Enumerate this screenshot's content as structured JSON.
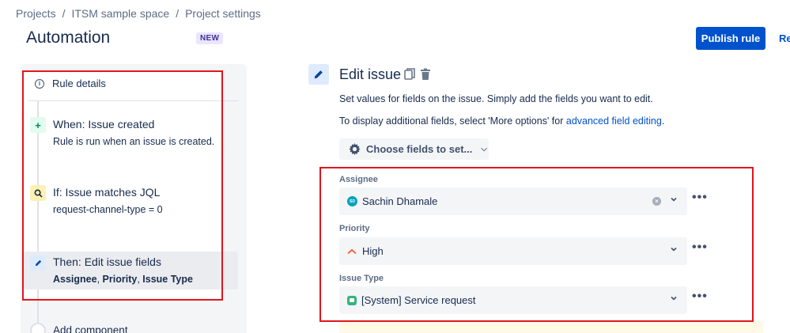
{
  "breadcrumb": [
    "Projects",
    "ITSM sample space",
    "Project settings"
  ],
  "header": {
    "title": "Automation",
    "badge": "NEW",
    "publish_label": "Publish rule",
    "secondary_label": "Re"
  },
  "rule": {
    "details_label": "Rule details",
    "when_title": "When: Issue created",
    "when_sub": "Rule is run when an issue is created.",
    "if_title": "If: Issue matches JQL",
    "if_sub": "request-channel-type = 0",
    "then_title": "Then: Edit issue fields",
    "then_fields": [
      "Assignee",
      "Priority",
      "Issue Type"
    ],
    "add_label": "Add component"
  },
  "editor": {
    "title": "Edit issue",
    "desc1": "Set values for fields on the issue. Simply add the fields you want to edit.",
    "desc2_prefix": "To display additional fields, select 'More options' for ",
    "desc2_link": "advanced field editing",
    "desc2_suffix": ".",
    "choose_label": "Choose fields to set...",
    "fields": [
      {
        "label": "Assignee",
        "value": "Sachin Dhamale",
        "avatar": "SD"
      },
      {
        "label": "Priority",
        "value": "High"
      },
      {
        "label": "Issue Type",
        "value": "[System] Service request"
      }
    ]
  },
  "colors": {
    "accent": "#0052cc",
    "highlight_box": "#e0161b",
    "priority_high": "#ff5630",
    "service_request": "#36b37e"
  }
}
